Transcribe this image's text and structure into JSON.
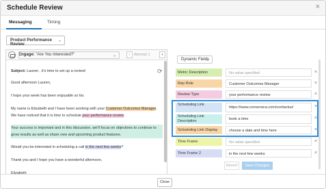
{
  "modal": {
    "title": "Schedule Review",
    "close_glyph": "×"
  },
  "tabs": [
    {
      "label": "Messaging"
    },
    {
      "label": "Timing"
    }
  ],
  "product_select": {
    "value": "Product Performance Review"
  },
  "engage": {
    "label": "Engage:",
    "value": "\"Are You Interested?\"",
    "attempt": "Attempt 1"
  },
  "email": {
    "subject_label": "Subject:",
    "subject": "Lauren , it's time to set up a review!",
    "greeting": "Good afternoon Lauren,",
    "line1": "I hope your week has been enjoyable so far.",
    "p2_a": "My name is Elizabeth and I have been working with your ",
    "p2_hl1": "Customer Outcomes Manager",
    "p2_b": ".",
    "p2_c": "We have noticed that it is time to schedule ",
    "p2_hl2": "your performance review",
    "p2_d": ".",
    "p3": "Your success is important and in this discussion, we'll focus on objectives to continue to grow results as well as share new and upcoming product features.",
    "p4_a": "Would you be interested in scheduling a call ",
    "p4_hl": "in the next few weeks",
    "p4_b": "?",
    "p5": "Thank you and I hope you have a wonderful afternoon,",
    "signature": "Elizabeth"
  },
  "dynamic_fields": {
    "button_label": "Dynamic Fields",
    "rows": [
      {
        "label": "Metric Description",
        "value": "No value specified",
        "color": "#d6efb0",
        "muted": true
      },
      {
        "label": "Rep Role",
        "value": "Customer Outcomes Manager",
        "color": "#f8d6a8",
        "muted": false
      },
      {
        "label": "Review Type",
        "value": "your performance review",
        "color": "#f4cbe0",
        "muted": false
      },
      {
        "label": "Scheduling Link",
        "value": "https://www.conversica.com/contactus/",
        "color": "#d4e4f6",
        "muted": false
      },
      {
        "label": "Scheduling Link Description",
        "value": "book a time",
        "color": "#c9f0ec",
        "muted": false
      },
      {
        "label": "Scheduling Link Display",
        "value": "choose a date and time here",
        "color": "#f8d6a8",
        "muted": false
      },
      {
        "label": "Time Frame",
        "value": "No value specified",
        "color": "#eef5a8",
        "muted": true
      },
      {
        "label": "Time Frame 2",
        "value": "in the next few weeks",
        "color": "#d8ddf6",
        "muted": false
      }
    ],
    "remove_glyph": "×"
  },
  "actions": {
    "revert": "Revert",
    "save": "Save Changes"
  },
  "footer": {
    "close": "Close"
  },
  "colors": {
    "accent": "#1a73b8",
    "highlight_border": "#2a8bd8",
    "save_bg": "#a9cfee"
  }
}
